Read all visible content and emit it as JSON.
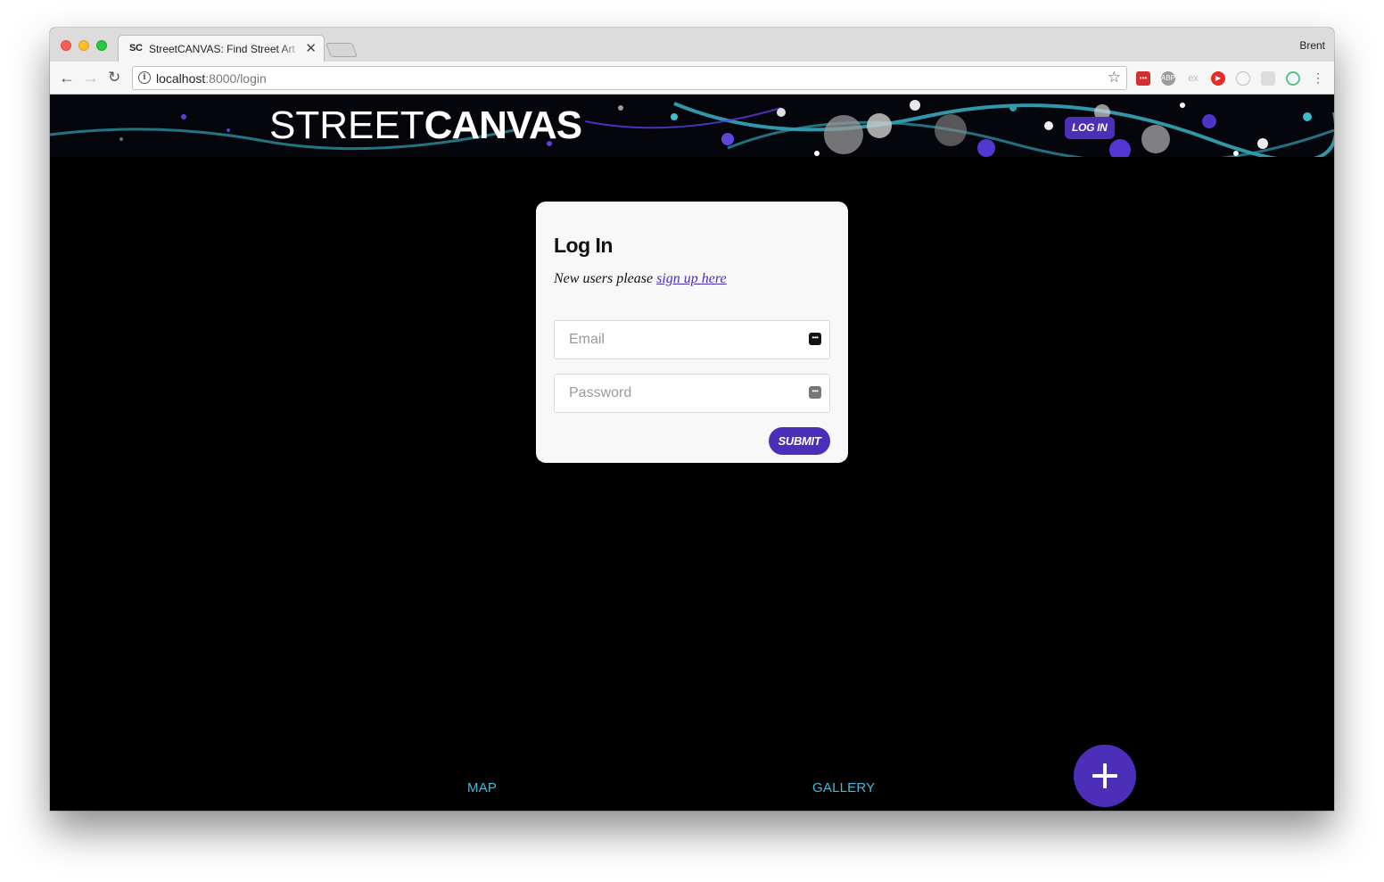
{
  "browser": {
    "tab_favicon": "SC",
    "tab_title": "StreetCANVAS: Find Street Art",
    "tab_close": "✕",
    "profile_name": "Brent",
    "url_host": "localhost",
    "url_port_path": ":8000/login",
    "back_icon": "←",
    "forward_icon": "→",
    "reload_icon": "↻",
    "star_icon": "☆",
    "extensions": [
      "lastpass",
      "adblock-plus",
      "ex",
      "youtube",
      "extension-1",
      "extension-2",
      "extension-3"
    ]
  },
  "header": {
    "logo_thin": "STREET",
    "logo_bold": "CANVAS",
    "login_label": "LOG IN"
  },
  "login": {
    "title": "Log In",
    "subtitle_prefix": "New users please",
    "signup_link": "sign up here",
    "email_placeholder": "Email",
    "password_placeholder": "Password",
    "submit_label": "SUBMIT"
  },
  "nav": {
    "map_label": "MAP",
    "gallery_label": "GALLERY",
    "add_icon": "plus-icon"
  },
  "colors": {
    "accent": "#4c2fb8",
    "link_cyan": "#47b9d6",
    "page_bg": "#000000",
    "card_bg": "#f8f8f8"
  }
}
